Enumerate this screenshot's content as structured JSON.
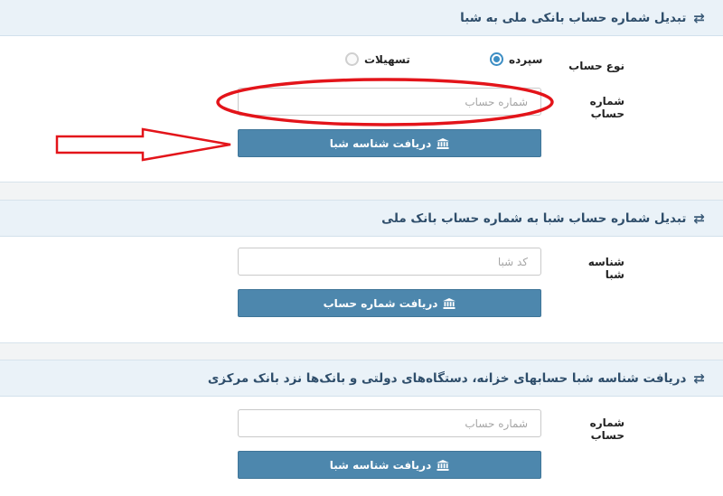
{
  "sections": [
    {
      "title": "تبدیل شماره حساب بانکی ملی به شبا",
      "account_type_label": "نوع حساب",
      "radio_deposit": "سپرده",
      "radio_loans": "تسهیلات",
      "account_number_label": "شماره حساب",
      "account_number_placeholder": "شماره حساب",
      "button_label": "دریافت شناسه شبا"
    },
    {
      "title": "تبدیل شماره حساب شبا به شماره حساب بانک ملی",
      "sheba_label": "شناسه شبا",
      "sheba_placeholder": "کد شبا",
      "button_label": "دریافت شماره حساب"
    },
    {
      "title": "دریافت شناسه شبا حسابهای خزانه، دستگاه‌های دولتی و بانک‌ها نزد بانک مرکزی",
      "account_number_label": "شماره حساب",
      "account_number_placeholder": "شماره حساب",
      "button_label": "دریافت شناسه شبا"
    }
  ],
  "colors": {
    "header_bg": "#eaf2f8",
    "header_text": "#2f4e6b",
    "button_bg": "#4d87ad",
    "radio_checked": "#3d8ec4",
    "annotation_red": "#e3141a"
  },
  "icons": {
    "header": "exchange-arrows-icon",
    "button": "bank-building-icon"
  }
}
